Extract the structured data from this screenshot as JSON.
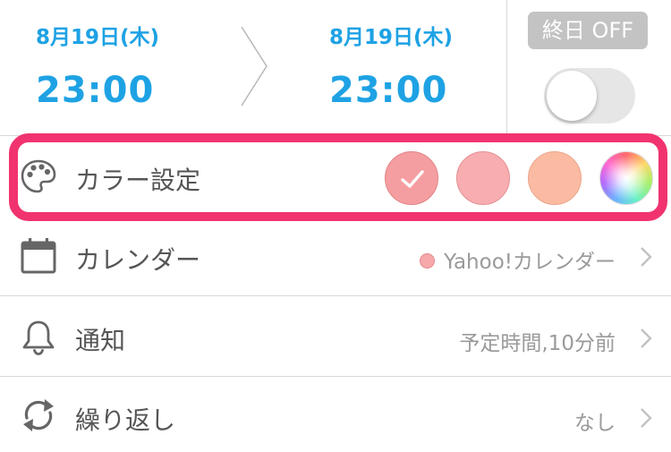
{
  "start": {
    "date": "8月19日(木)",
    "time": "23:00"
  },
  "end": {
    "date": "8月19日(木)",
    "time": "23:00"
  },
  "all_day": {
    "label": "終日 OFF",
    "toggle_on": false
  },
  "color_row": {
    "label": "カラー設定",
    "icon": "palette-icon",
    "swatches": [
      {
        "color": "#f59ea1",
        "selected": true
      },
      {
        "color": "#f8adb0",
        "selected": false
      },
      {
        "color": "#fbbba3",
        "selected": false
      },
      {
        "color": "rainbow",
        "selected": false
      }
    ],
    "highlight_color": "#f1336f"
  },
  "calendar_row": {
    "label": "カレンダー",
    "icon": "calendar-icon",
    "value": "Yahoo!カレンダー",
    "dot_color": "#f7a8ab"
  },
  "notification_row": {
    "label": "通知",
    "icon": "bell-icon",
    "value": "予定時間,10分前"
  },
  "repeat_row": {
    "label": "繰り返し",
    "icon": "repeat-icon",
    "value": "なし"
  },
  "accent_color": "#1ea2e4"
}
